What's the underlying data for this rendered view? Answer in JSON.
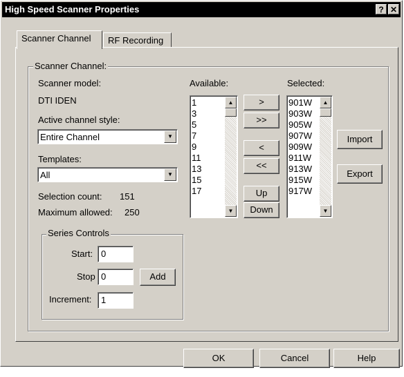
{
  "window": {
    "title": "High Speed Scanner Properties",
    "help_glyph": "?",
    "close_glyph": "✕"
  },
  "tabs": [
    {
      "label": "Scanner Channel"
    },
    {
      "label": "RF Recording"
    }
  ],
  "group": {
    "label": "Scanner Channel:"
  },
  "scanner_model": {
    "label": "Scanner model:",
    "value": "DTI IDEN"
  },
  "active_channel_style": {
    "label": "Active channel style:",
    "value": "Entire Channel"
  },
  "templates": {
    "label": "Templates:",
    "value": "All"
  },
  "selection_count": {
    "label": "Selection count:",
    "value": "151"
  },
  "maximum_allowed": {
    "label": "Maximum allowed:",
    "value": "250"
  },
  "series": {
    "label": "Series Controls",
    "start_label": "Start:",
    "start_value": "0",
    "stop_label": "Stop",
    "stop_value": "0",
    "increment_label": "Increment:",
    "increment_value": "1",
    "add_label": "Add"
  },
  "available": {
    "label": "Available:",
    "items": [
      "1",
      "3",
      "5",
      "7",
      "9",
      "11",
      "13",
      "15",
      "17"
    ]
  },
  "selected": {
    "label": "Selected:",
    "items": [
      "901W",
      "903W",
      "905W",
      "907W",
      "909W",
      "911W",
      "913W",
      "915W",
      "917W"
    ]
  },
  "move_buttons": {
    "add_one": ">",
    "add_all": ">>",
    "remove_one": "<",
    "remove_all": "<<",
    "up": "Up",
    "down": "Down"
  },
  "side_buttons": {
    "import": "Import",
    "export": "Export"
  },
  "footer": {
    "ok": "OK",
    "cancel": "Cancel",
    "help": "Help"
  }
}
